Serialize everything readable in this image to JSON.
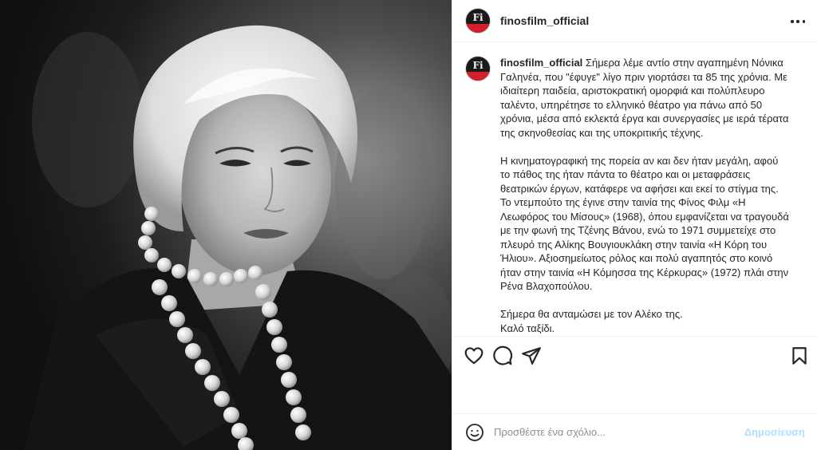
{
  "post": {
    "username": "finosfilm_official",
    "avatar_mark": "Fi",
    "photo_alt": "",
    "caption_paragraphs": [
      [
        "Σήμερα λέμε αντίο στην αγαπημένη Νόνικα",
        "Γαληνέα, που \"έφυγε\" λίγο πριν γιορτάσει τα 85 της χρόνια. Με",
        "ιδιαίτερη παιδεία, αριστοκρατική ομορφιά και πολύπλευρο",
        "ταλέντο, υπηρέτησε το ελληνικό θέατρο για πάνω από 50",
        "χρόνια, μέσα από εκλεκτά έργα και συνεργασίες με ιερά τέρατα",
        "της σκηνοθεσίας και της υποκριτικής τέχνης."
      ],
      [
        "Η κινηματογραφική της πορεία αν και δεν ήταν μεγάλη, αφού",
        "το πάθος της ήταν πάντα το θέατρο και οι μεταφράσεις",
        "θεατρικών έργων, κατάφερε να αφήσει και εκεί το στίγμα της.",
        "Το ντεμπούτο της έγινε στην ταινία της Φίνος Φιλμ «Η",
        "Λεωφόρος του Μίσους» (1968), όπου εμφανίζεται να τραγουδά",
        "με την φωνή της Τζένης Βάνου, ενώ το 1971 συμμετείχε στο",
        "πλευρό της Αλίκης Βουγιουκλάκη στην ταινία «Η Κόρη του",
        "Ήλιου». Αξιοσημείωτος ρόλος και πολύ αγαπητός στο κοινό",
        "ήταν στην ταινία «Η Κόμησσα της Κέρκυρας» (1972) πλάι στην",
        "Ρένα Βλαχοπούλου."
      ],
      [
        "Σήμερα θα ανταμώσει με τον Αλέκο της.",
        "Καλό ταξίδι."
      ]
    ]
  },
  "actions": {
    "like_icon": "heart-icon",
    "comment_icon": "comment-icon",
    "share_icon": "paper-plane-icon",
    "save_icon": "bookmark-icon"
  },
  "comment": {
    "placeholder": "Προσθέστε ένα σχόλιο...",
    "post_label": "Δημοσίευση",
    "post_color": "#b2dffc"
  },
  "colors": {
    "brand_red": "#d3202a",
    "text": "#262626",
    "muted": "#8e8e8e",
    "border": "#efefef"
  }
}
